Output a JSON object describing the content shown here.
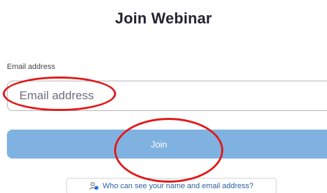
{
  "header": {
    "title": "Join Webinar"
  },
  "form": {
    "email_label": "Email address",
    "email_placeholder": "Email address",
    "email_value": "",
    "join_label": "Join"
  },
  "privacy": {
    "link_text": "Who can see your name and email address?",
    "icon": "people-icon"
  },
  "colors": {
    "join_button": "#7fb2e0",
    "annotation": "#e01b1b",
    "link": "#2d5fa0"
  }
}
